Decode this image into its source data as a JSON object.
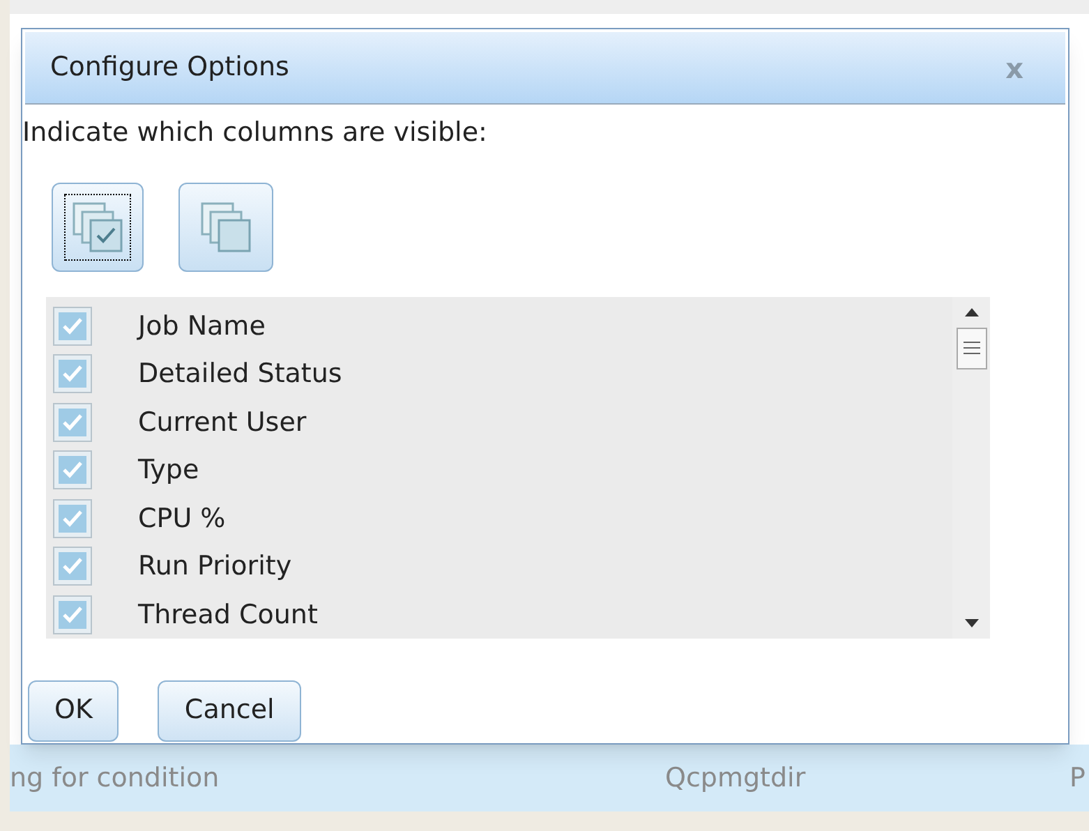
{
  "background_row": {
    "column_1": "ng for condition",
    "column_2": "Qcpmgtdir",
    "column_3": "P"
  },
  "dialog": {
    "title": "Configure Options",
    "close": "x",
    "instruction": "Indicate which columns are visible:",
    "columns": [
      {
        "label": "Job Name",
        "checked": true
      },
      {
        "label": "Detailed Status",
        "checked": true
      },
      {
        "label": "Current User",
        "checked": true
      },
      {
        "label": "Type",
        "checked": true
      },
      {
        "label": "CPU %",
        "checked": true
      },
      {
        "label": "Run Priority",
        "checked": true
      },
      {
        "label": "Thread Count",
        "checked": true
      }
    ],
    "buttons": [
      "OK",
      "Cancel"
    ]
  }
}
